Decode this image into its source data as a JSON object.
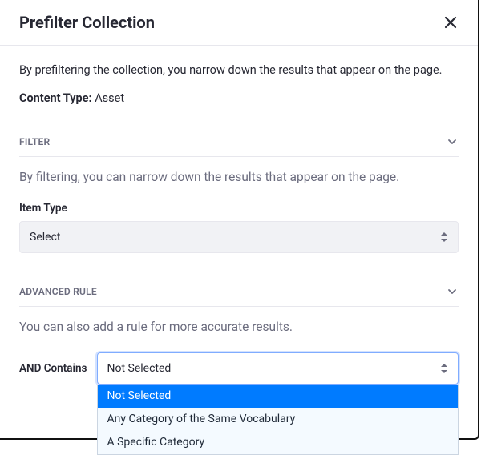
{
  "header": {
    "title": "Prefilter Collection"
  },
  "intro": {
    "description": "By prefiltering the collection, you narrow down the results that appear on the page.",
    "content_type_label": "Content Type:",
    "content_type_value": "Asset"
  },
  "filter": {
    "section_label": "FILTER",
    "description": "By filtering, you can narrow down the results that appear on the page.",
    "item_type_label": "Item Type",
    "item_type_selected": "Select"
  },
  "advanced": {
    "section_label": "ADVANCED RULE",
    "description": "You can also add a rule for more accurate results.",
    "rule_prefix": "AND Contains",
    "selected_value": "Not Selected",
    "options": [
      "Not Selected",
      "Any Category of the Same Vocabulary",
      "A Specific Category"
    ]
  }
}
